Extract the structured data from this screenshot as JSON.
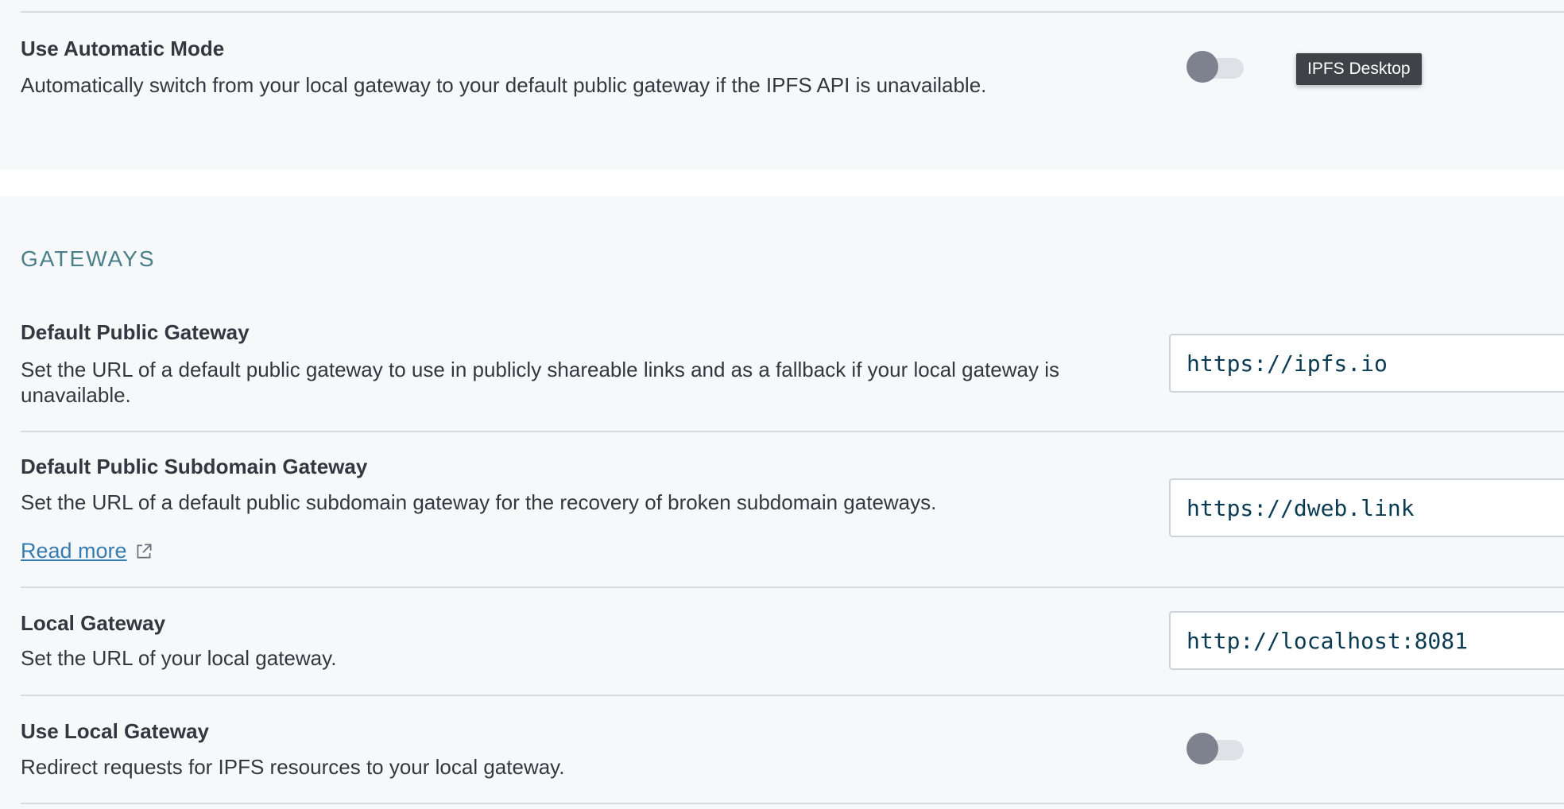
{
  "automatic_mode": {
    "title": "Use Automatic Mode",
    "description": "Automatically switch from your local gateway to your default public gateway if the IPFS API is unavailable.",
    "enabled": false
  },
  "tooltip": {
    "text": "IPFS Desktop"
  },
  "gateways": {
    "section_title": "GATEWAYS",
    "default_public": {
      "title": "Default Public Gateway",
      "description": "Set the URL of a default public gateway to use in publicly shareable links and as a fallback if your local gateway is unavailable.",
      "value": "https://ipfs.io"
    },
    "default_subdomain": {
      "title": "Default Public Subdomain Gateway",
      "description": "Set the URL of a default public subdomain gateway for the recovery of broken subdomain gateways.",
      "read_more": "Read more",
      "value": "https://dweb.link"
    },
    "local": {
      "title": "Local Gateway",
      "description": "Set the URL of your local gateway.",
      "value": "http://localhost:8081"
    },
    "use_local": {
      "title": "Use Local Gateway",
      "description": "Redirect requests for IPFS resources to your local gateway.",
      "enabled": false
    }
  },
  "icons": {
    "external_link": "external-link-icon"
  },
  "colors": {
    "panel_bg": "#f7f8fa",
    "section_title": "#4a8089",
    "link": "#357cb0",
    "input_text": "#0b3a53",
    "toggle_knob": "#7e828f",
    "toggle_track": "#dfe1e6",
    "tooltip_bg": "#404247"
  }
}
